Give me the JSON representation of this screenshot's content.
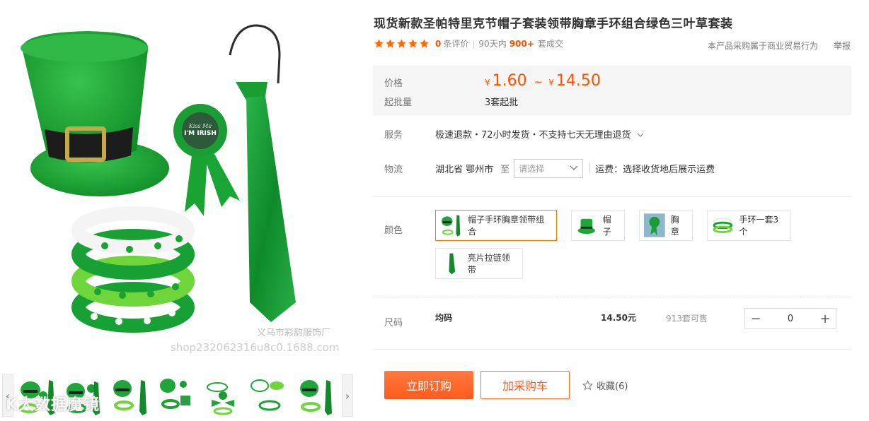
{
  "product": {
    "title": "现货新款圣帕特里克节帽子套装领带胸章手环组合绿色三叶草套装",
    "reviews_count": "0",
    "reviews_label": "条评价",
    "sales_prefix": "90天内",
    "sales_count": "900+",
    "sales_suffix": "套成交",
    "trade_note": "本产品采购属于商业贸易行为",
    "report_label": "举报"
  },
  "price": {
    "label": "价格",
    "currency": "¥",
    "low": "1.60",
    "tilde": "~",
    "high": "14.50",
    "moq_label": "起批量",
    "moq_value": "3套起批"
  },
  "service": {
    "label": "服务",
    "text": "极速退款・72小时发货・不支持七天无理由退货"
  },
  "logistics": {
    "label": "物流",
    "origin": "湖北省 鄂州市",
    "to": "至",
    "select_placeholder": "请选择",
    "fee_text": "运费：选择收货地后展示运费"
  },
  "color": {
    "label": "颜色",
    "options": [
      {
        "name": "帽子手环胸章领带组合",
        "selected": true
      },
      {
        "name": "帽子",
        "selected": false
      },
      {
        "name": "胸章",
        "selected": false
      },
      {
        "name": "手环一套3个",
        "selected": false
      },
      {
        "name": "亮片拉链领带",
        "selected": false
      }
    ]
  },
  "size": {
    "label": "尺码",
    "name": "均码",
    "price": "14.50元",
    "stock": "913套可售",
    "qty": "0",
    "minus": "−",
    "plus": "+"
  },
  "actions": {
    "buy": "立即订购",
    "cart": "加采购车",
    "favorite": "收藏(6)"
  },
  "gallery": {
    "watermark_cn": "义乌市彩韵服饰厂",
    "watermark_url": "shop232062316u8c0.1688.com",
    "logo_text": "K大数据魔镜",
    "prev": "‹",
    "next": "›",
    "badge_text": "I'M IRISH",
    "badge_small": "Kiss Me"
  },
  "colors": {
    "accent": "#ff5000",
    "green": "#1fa53a",
    "dark_green": "#0f7a24"
  }
}
